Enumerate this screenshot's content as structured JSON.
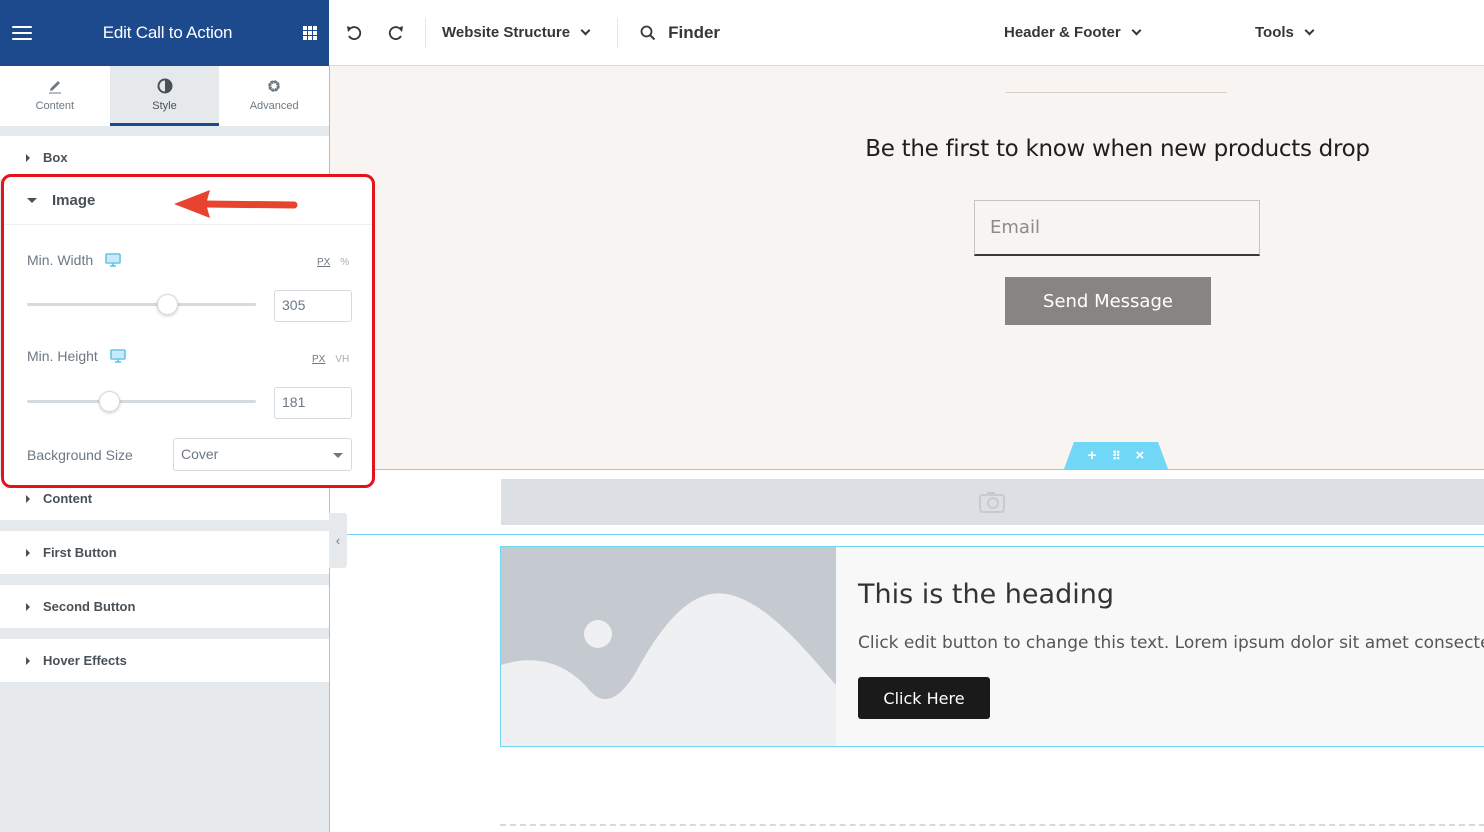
{
  "panel": {
    "title": "Edit Call to Action",
    "tabs": [
      {
        "label": "Content",
        "icon": "pencil-icon"
      },
      {
        "label": "Style",
        "icon": "contrast-icon",
        "active": true
      },
      {
        "label": "Advanced",
        "icon": "gear-icon"
      }
    ],
    "sections_above": [
      {
        "label": "Box"
      }
    ],
    "image_section": {
      "label": "Image",
      "min_width": {
        "label": "Min. Width",
        "units": [
          "PX",
          "%"
        ],
        "active_unit": "PX",
        "value": "305",
        "fraction": 0.61
      },
      "min_height": {
        "label": "Min. Height",
        "units": [
          "PX",
          "VH"
        ],
        "active_unit": "PX",
        "value": "181",
        "fraction": 0.36
      },
      "background_size": {
        "label": "Background Size",
        "value": "Cover"
      }
    },
    "sections_below": [
      {
        "label": "Content"
      },
      {
        "label": "First Button"
      },
      {
        "label": "Second Button"
      },
      {
        "label": "Hover Effects"
      }
    ]
  },
  "topbar": {
    "website_structure": "Website Structure",
    "finder": "Finder",
    "header_footer": "Header & Footer",
    "tools": "Tools"
  },
  "canvas": {
    "subscribe_heading": "Be the first to know when new products drop",
    "email_placeholder": "Email",
    "send_button": "Send Message",
    "cta": {
      "heading": "This is the heading",
      "text": "Click edit button to change this text. Lorem ipsum dolor sit amet consectetur",
      "button": "Click Here"
    }
  },
  "colors": {
    "panel_header": "#1c4a8c",
    "highlight_border": "#e3131b",
    "arrow": "#e8432e",
    "section_accent": "#71d7f7",
    "responsive_icon": "#5bc2e7"
  }
}
